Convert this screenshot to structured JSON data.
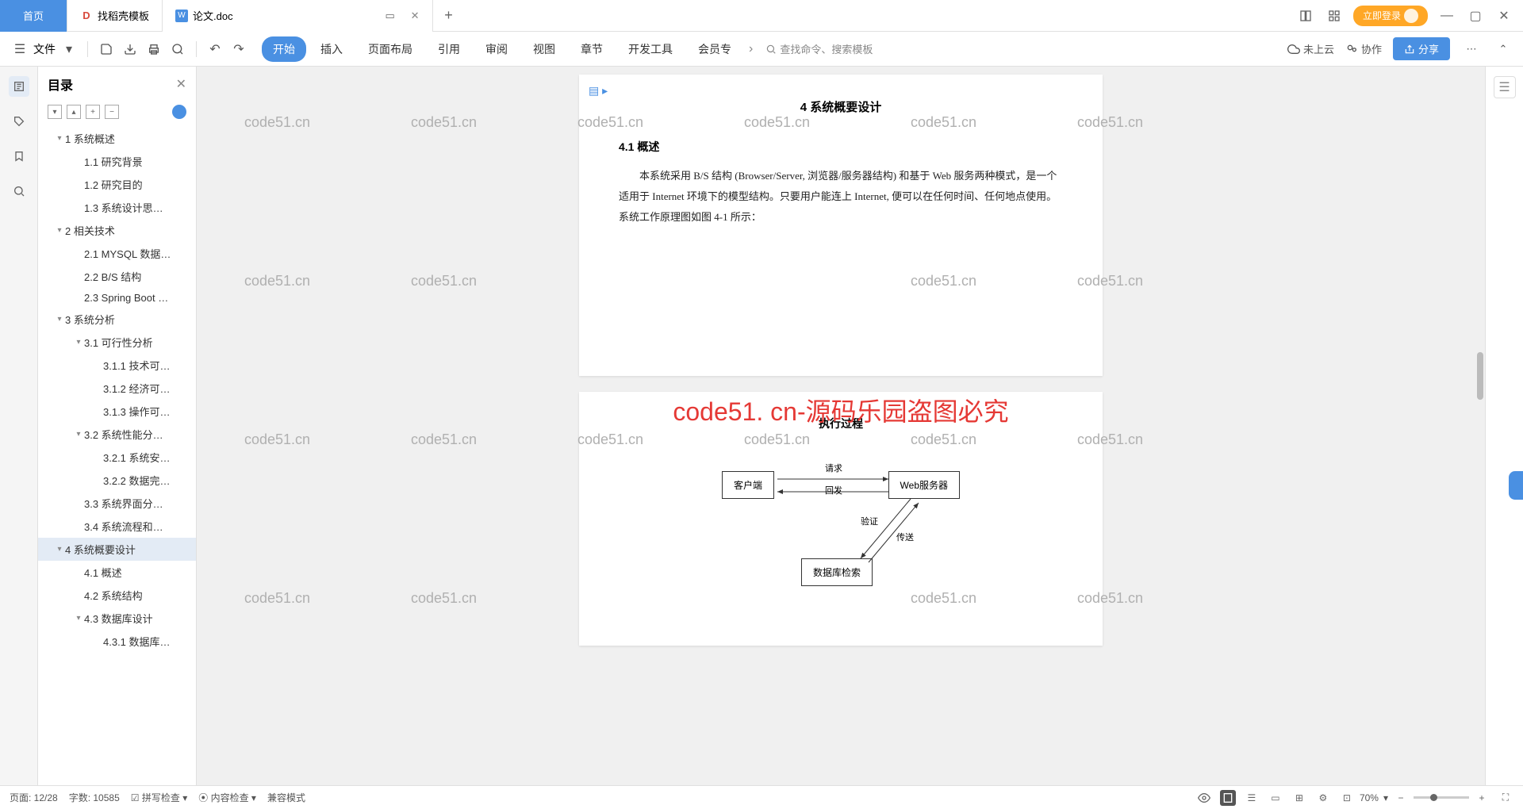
{
  "tabs": {
    "home": "首页",
    "template": "找稻壳模板",
    "doc": "论文.doc"
  },
  "titlebar": {
    "login": "立即登录"
  },
  "toolbar": {
    "file": "文件",
    "menus": [
      "开始",
      "插入",
      "页面布局",
      "引用",
      "审阅",
      "视图",
      "章节",
      "开发工具",
      "会员专"
    ],
    "search_placeholder": "查找命令、搜索模板",
    "cloud": "未上云",
    "coop": "协作",
    "share": "分享"
  },
  "outline": {
    "title": "目录",
    "items": [
      {
        "l": 1,
        "chev": "▾",
        "t": "1 系统概述"
      },
      {
        "l": 2,
        "t": "1.1 研究背景"
      },
      {
        "l": 2,
        "t": "1.2 研究目的"
      },
      {
        "l": 2,
        "t": "1.3 系统设计思…"
      },
      {
        "l": 1,
        "chev": "▾",
        "t": "2 相关技术"
      },
      {
        "l": 2,
        "t": "2.1 MYSQL 数据…"
      },
      {
        "l": 2,
        "t": "2.2 B/S 结构"
      },
      {
        "l": 2,
        "t": "2.3 Spring Boot …"
      },
      {
        "l": 1,
        "chev": "▾",
        "t": "3 系统分析"
      },
      {
        "l": 2,
        "chev": "▾",
        "t": "3.1 可行性分析"
      },
      {
        "l": 3,
        "t": "3.1.1 技术可…"
      },
      {
        "l": 3,
        "t": "3.1.2 经济可…"
      },
      {
        "l": 3,
        "t": "3.1.3 操作可…"
      },
      {
        "l": 2,
        "chev": "▾",
        "t": "3.2 系统性能分…"
      },
      {
        "l": 3,
        "t": "3.2.1 系统安…"
      },
      {
        "l": 3,
        "t": "3.2.2 数据完…"
      },
      {
        "l": 2,
        "t": "3.3 系统界面分…"
      },
      {
        "l": 2,
        "t": "3.4 系统流程和…"
      },
      {
        "l": 1,
        "chev": "▾",
        "t": "4 系统概要设计",
        "sel": true
      },
      {
        "l": 2,
        "t": "4.1 概述"
      },
      {
        "l": 2,
        "t": "4.2 系统结构"
      },
      {
        "l": 2,
        "chev": "▾",
        "t": "4.3 数据库设计"
      },
      {
        "l": 3,
        "t": "4.3.1 数据库…"
      }
    ]
  },
  "document": {
    "page1": {
      "title": "4 系统概要设计",
      "h2": "4.1 概述",
      "para": "本系统采用 B/S 结构 (Browser/Server, 浏览器/服务器结构) 和基于 Web 服务两种模式，是一个适用于 Internet 环境下的模型结构。只要用户能连上 Internet, 便可以在任何时间、任何地点使用。系统工作原理图如图 4-1 所示："
    },
    "watermark_big": "code51. cn-源码乐园盗图必究",
    "watermark_small": "code51.cn",
    "page2": {
      "title": "执行过程",
      "boxes": {
        "client": "客户端",
        "web": "Web服务器",
        "db": "数据库检索"
      },
      "labels": {
        "req": "请求",
        "resp": "回发",
        "verify": "验证",
        "send": "传送"
      }
    }
  },
  "statusbar": {
    "page": "页面: 12/28",
    "words": "字数: 10585",
    "spell": "拼写检查",
    "content": "内容检查",
    "compat": "兼容模式",
    "zoom": "70%"
  }
}
